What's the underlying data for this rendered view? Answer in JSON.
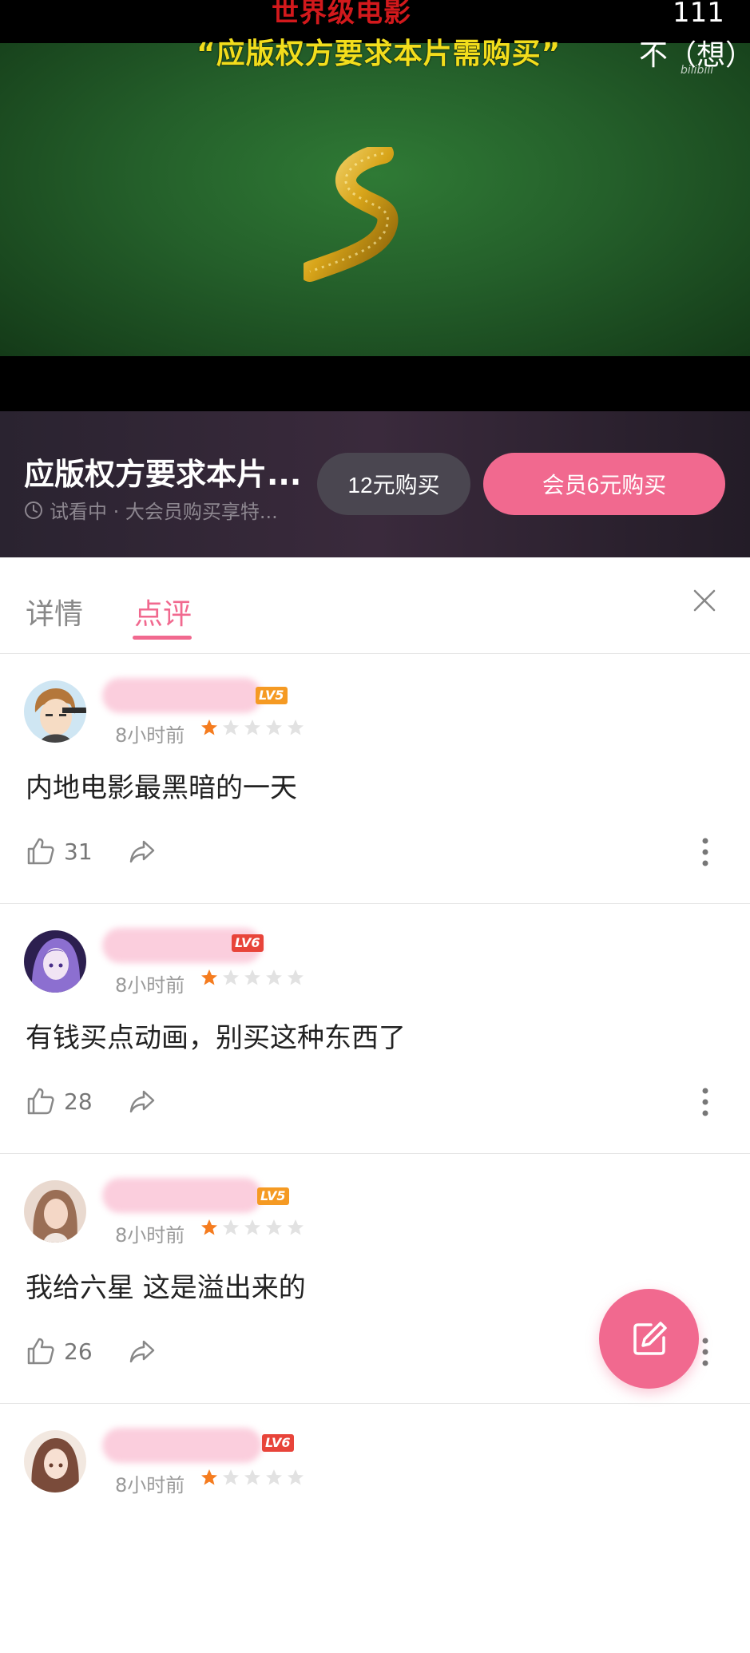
{
  "video": {
    "subtitle_top": "世界级电影",
    "subtitle_main": "“应版权方要求本片需购买”",
    "danmaku_count": "111",
    "danmaku_text": "不（想）",
    "watermark": "bilibili"
  },
  "purchase": {
    "title": "应版权方要求本片...",
    "subtitle": "试看中 · 大会员购买享特...",
    "buy_label": "12元购买",
    "vip_buy_label": "会员6元购买"
  },
  "tabs": [
    {
      "label": "详情"
    },
    {
      "label": "点评",
      "active": true
    }
  ],
  "colors": {
    "accent": "#f1698f",
    "star": "#f57c1f",
    "level5": "#f59a23",
    "level6": "#e8443a"
  },
  "comments": [
    {
      "level": "LV5",
      "time": "8小时前",
      "rating": 1,
      "text": "内地电影最黑暗的一天",
      "likes": "31"
    },
    {
      "level": "LV6",
      "time": "8小时前",
      "rating": 1,
      "text": "有钱买点动画，别买这种东西了",
      "likes": "28"
    },
    {
      "level": "LV5",
      "time": "8小时前",
      "rating": 1,
      "text": "我给六星 这是溢出来的",
      "likes": "26"
    },
    {
      "level": "LV6",
      "time": "8小时前",
      "rating": 1,
      "text": "",
      "likes": ""
    }
  ]
}
